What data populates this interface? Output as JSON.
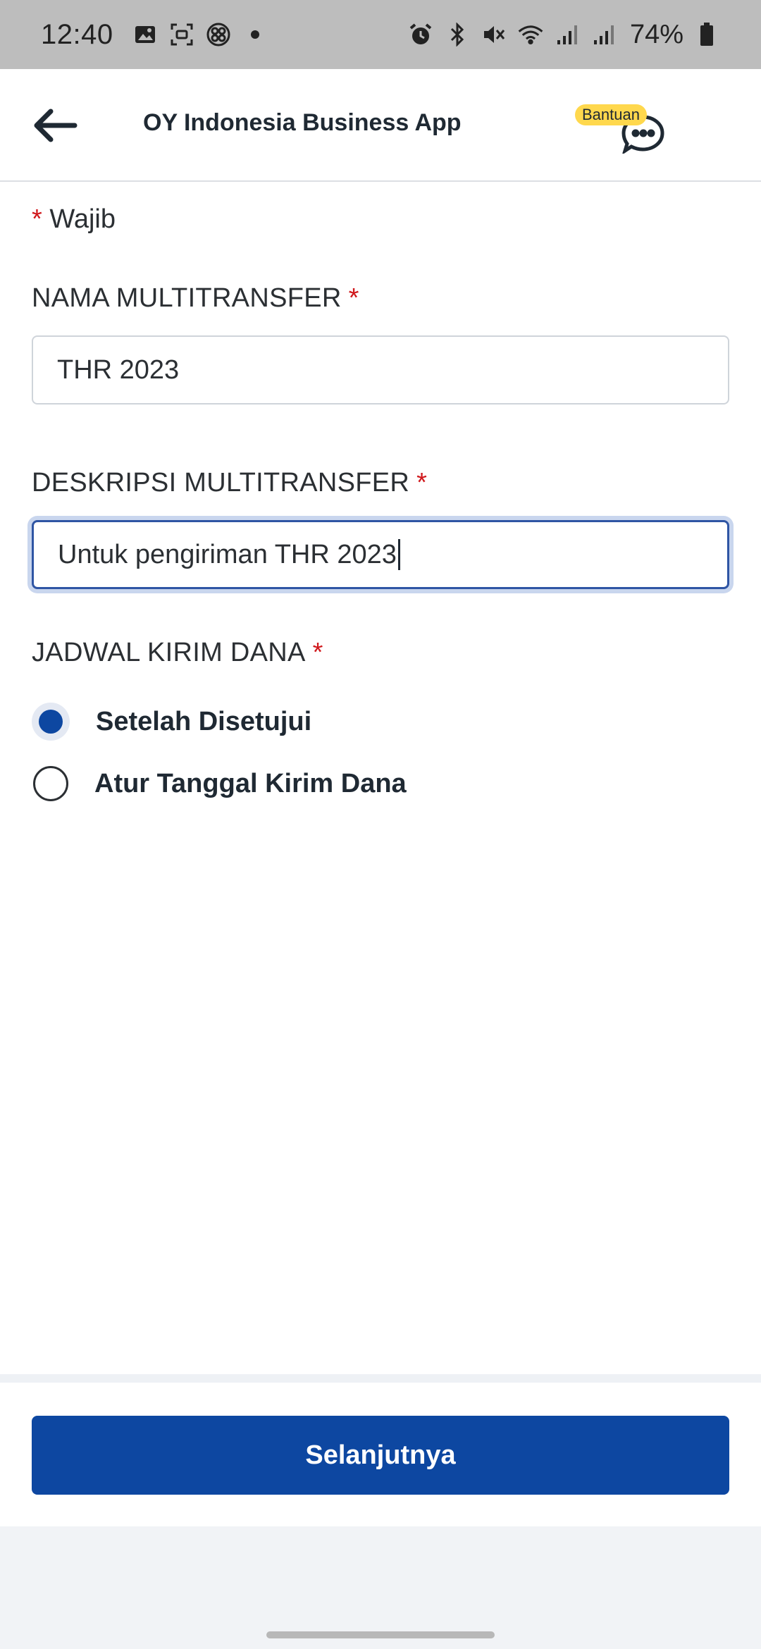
{
  "status_bar": {
    "time": "12:40",
    "battery": "74%",
    "icons": [
      "gallery-icon",
      "screen-record-icon",
      "app-icon",
      "dot-icon",
      "alarm-icon",
      "bluetooth-icon",
      "mute-icon",
      "wifi-icon",
      "signal-icon",
      "signal-icon",
      "battery-icon"
    ]
  },
  "header": {
    "title": "OY Indonesia Business App",
    "help_badge": "Bantuan"
  },
  "form": {
    "required_note": "Wajib",
    "required_mark": "*",
    "nama": {
      "label": "NAMA MULTITRANSFER",
      "value": "THR 2023"
    },
    "deskripsi": {
      "label": "DESKRIPSI MULTITRANSFER",
      "value": "Untuk pengiriman THR 2023"
    },
    "jadwal": {
      "label": "JADWAL KIRIM DANA",
      "options": [
        {
          "label": "Setelah Disetujui",
          "selected": true
        },
        {
          "label": "Atur Tanggal Kirim Dana",
          "selected": false
        }
      ]
    }
  },
  "footer": {
    "next_label": "Selanjutnya"
  },
  "colors": {
    "primary": "#0d47a1",
    "required": "#d0191d",
    "badge": "#ffd84d",
    "status_bar": "#bdbdbd"
  }
}
